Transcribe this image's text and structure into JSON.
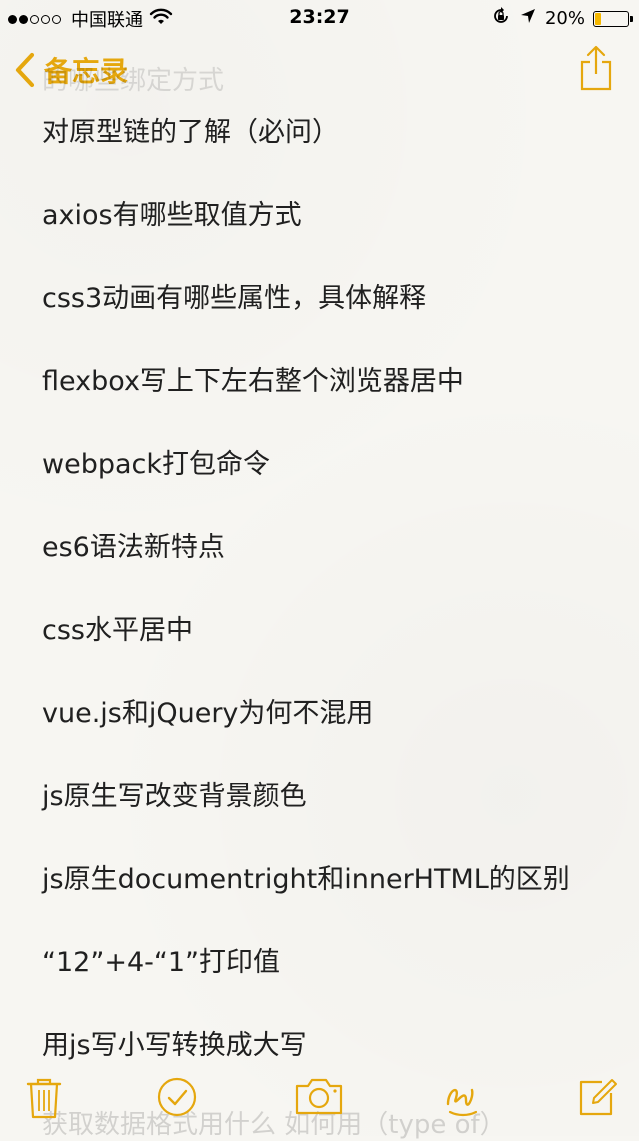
{
  "status_bar": {
    "carrier": "中国联通",
    "time": "23:27",
    "battery_text": "20%",
    "battery_level": 0.2,
    "signal_bars_filled": 2,
    "signal_bars_total": 5
  },
  "nav": {
    "back_label": "备忘录",
    "ghost_title": "的哪些绑定方式"
  },
  "note": {
    "lines": [
      "对原型链的了解（必问）",
      "axios有哪些取值方式",
      "css3动画有哪些属性，具体解释",
      "flexbox写上下左右整个浏览器居中",
      "webpack打包命令",
      "es6语法新特点",
      "css水平居中",
      "vue.js和jQuery为何不混用",
      "js原生写改变背景颜色",
      "js原生documentright和innerHTML的区别",
      "“12”+4-“1”打印值",
      "用js写小写转换成大写"
    ],
    "ghost_bottom": "获取数据格式用什么 如何用（type of）"
  },
  "colors": {
    "accent": "#e5a70e",
    "battery": "#f5b800",
    "background": "#f7f6f2"
  },
  "toolbar": {
    "icons": [
      "trash-icon",
      "checkmark-icon",
      "camera-icon",
      "sketch-icon",
      "compose-icon"
    ]
  }
}
